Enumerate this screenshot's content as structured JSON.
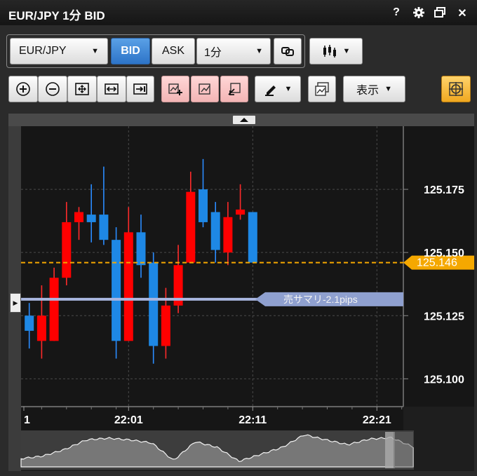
{
  "window": {
    "title": "EUR/JPY 1分 BID",
    "help": "?",
    "close": "✕"
  },
  "toolbar": {
    "symbol": "EUR/JPY",
    "bid": "BID",
    "ask": "ASK",
    "timeframe": "1分",
    "display": "表示",
    "caret": "▼"
  },
  "colors": {
    "bull": "#ff0000",
    "bear": "#1e88e5",
    "price_line": "#f5a800",
    "summary_line": "#a9b6e0",
    "wick_bull": "#ff2a2a",
    "wick_bear": "#2a8cff"
  },
  "chart_data": {
    "type": "candlestick",
    "symbol": "EUR/JPY",
    "timeframe": "1分",
    "price_side": "BID",
    "x_ticks": [
      "1",
      "22:01",
      "22:11",
      "22:21"
    ],
    "y_ticks": [
      125.1,
      125.125,
      125.15,
      125.175
    ],
    "y_tick_labels": [
      "125.100",
      "125.125",
      "125.150",
      "125.175"
    ],
    "ylim": [
      125.089,
      125.2
    ],
    "current_price": 125.146,
    "current_price_label": "125.146",
    "summary_line": {
      "label": "売サマリ-2.1pips",
      "value": 125.1315
    },
    "candles": [
      {
        "o": 125.125,
        "h": 125.13,
        "l": 125.112,
        "c": 125.119
      },
      {
        "o": 125.115,
        "h": 125.137,
        "l": 125.108,
        "c": 125.125
      },
      {
        "o": 125.115,
        "h": 125.144,
        "l": 125.115,
        "c": 125.14
      },
      {
        "o": 125.14,
        "h": 125.17,
        "l": 125.137,
        "c": 125.162
      },
      {
        "o": 125.162,
        "h": 125.168,
        "l": 125.155,
        "c": 125.166
      },
      {
        "o": 125.165,
        "h": 125.177,
        "l": 125.154,
        "c": 125.162
      },
      {
        "o": 125.165,
        "h": 125.184,
        "l": 125.153,
        "c": 125.155
      },
      {
        "o": 125.155,
        "h": 125.16,
        "l": 125.108,
        "c": 125.115
      },
      {
        "o": 125.115,
        "h": 125.168,
        "l": 125.115,
        "c": 125.158
      },
      {
        "o": 125.158,
        "h": 125.165,
        "l": 125.14,
        "c": 125.145
      },
      {
        "o": 125.146,
        "h": 125.15,
        "l": 125.106,
        "c": 125.113
      },
      {
        "o": 125.113,
        "h": 125.136,
        "l": 125.108,
        "c": 125.129
      },
      {
        "o": 125.129,
        "h": 125.153,
        "l": 125.126,
        "c": 125.145
      },
      {
        "o": 125.146,
        "h": 125.182,
        "l": 125.146,
        "c": 125.174
      },
      {
        "o": 125.175,
        "h": 125.187,
        "l": 125.16,
        "c": 125.162
      },
      {
        "o": 125.166,
        "h": 125.17,
        "l": 125.146,
        "c": 125.151
      },
      {
        "o": 125.15,
        "h": 125.17,
        "l": 125.145,
        "c": 125.164
      },
      {
        "o": 125.165,
        "h": 125.177,
        "l": 125.163,
        "c": 125.167
      },
      {
        "o": 125.166,
        "h": 125.166,
        "l": 125.146,
        "c": 125.146
      }
    ]
  }
}
